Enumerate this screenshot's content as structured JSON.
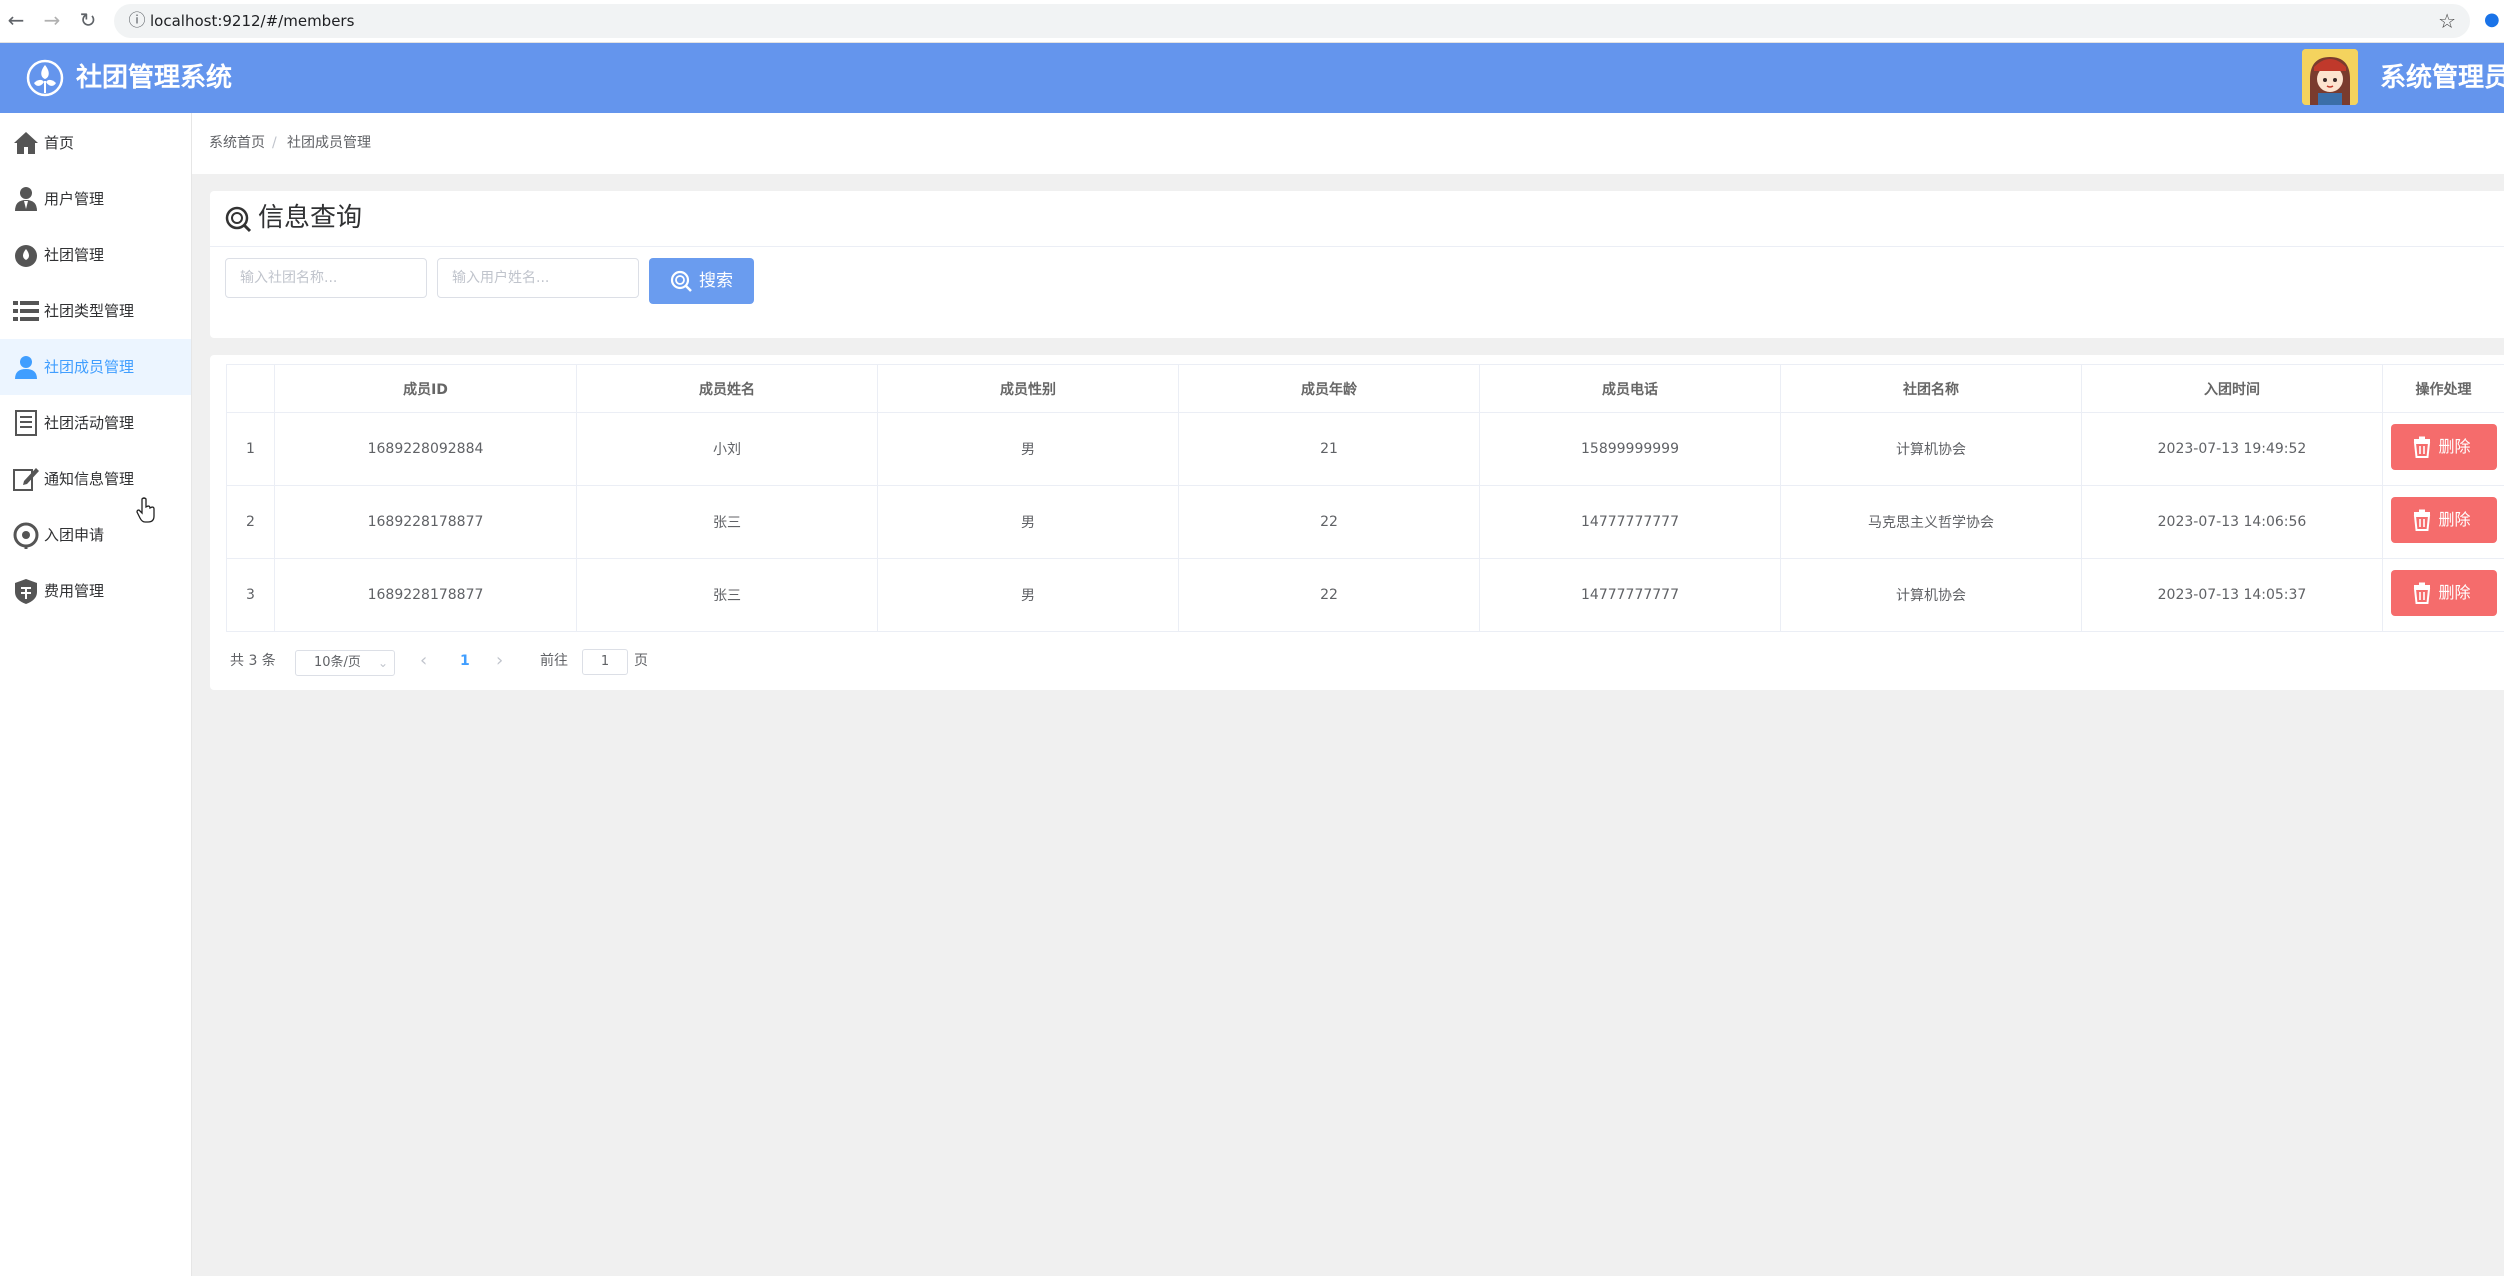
{
  "browser": {
    "url": "localhost:9212/#/members"
  },
  "header": {
    "title": "社团管理系统",
    "user": "系统管理员"
  },
  "sidebar": {
    "items": [
      {
        "label": "首页",
        "icon": "home-icon"
      },
      {
        "label": "用户管理",
        "icon": "user-icon"
      },
      {
        "label": "社团管理",
        "icon": "drop-icon"
      },
      {
        "label": "社团类型管理",
        "icon": "list-icon"
      },
      {
        "label": "社团成员管理",
        "icon": "member-icon",
        "active": true
      },
      {
        "label": "社团活动管理",
        "icon": "document-icon"
      },
      {
        "label": "通知信息管理",
        "icon": "edit-icon"
      },
      {
        "label": "入团申请",
        "icon": "location-icon"
      },
      {
        "label": "费用管理",
        "icon": "coin-icon"
      }
    ]
  },
  "breadcrumb": {
    "home": "系统首页",
    "separator": "/",
    "current": "社团成员管理"
  },
  "search": {
    "title": "信息查询",
    "club_placeholder": "输入社团名称...",
    "user_placeholder": "输入用户姓名...",
    "button": "搜索"
  },
  "table": {
    "headers": [
      "",
      "成员ID",
      "成员姓名",
      "成员性别",
      "成员年龄",
      "成员电话",
      "社团名称",
      "入团时间",
      "操作处理"
    ],
    "rows": [
      {
        "index": "1",
        "id": "1689228092884",
        "name": "小刘",
        "gender": "男",
        "age": "21",
        "phone": "15899999999",
        "club": "计算机协会",
        "time": "2023-07-13 19:49:52"
      },
      {
        "index": "2",
        "id": "1689228178877",
        "name": "张三",
        "gender": "男",
        "age": "22",
        "phone": "14777777777",
        "club": "马克思主义哲学协会",
        "time": "2023-07-13 14:06:56"
      },
      {
        "index": "3",
        "id": "1689228178877",
        "name": "张三",
        "gender": "男",
        "age": "22",
        "phone": "14777777777",
        "club": "计算机协会",
        "time": "2023-07-13 14:05:37"
      }
    ],
    "delete_label": "删除"
  },
  "pagination": {
    "total": "共 3 条",
    "page_size": "10条/页",
    "prev": "‹",
    "current_page": "1",
    "next": "›",
    "goto_prefix": "前往",
    "goto_value": "1",
    "goto_suffix": "页"
  },
  "colors": {
    "header_bg": "#6495ed",
    "active_text": "#409eff",
    "delete_bg": "#f56c6c",
    "search_btn": "#6a9cef"
  }
}
